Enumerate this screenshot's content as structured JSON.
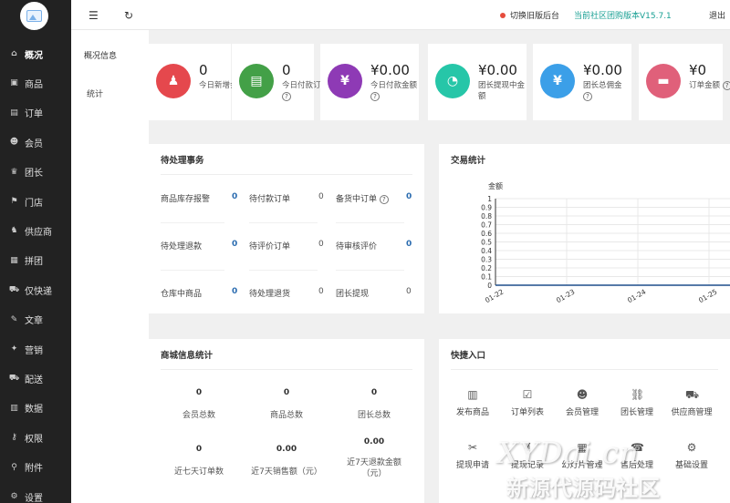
{
  "sidebar": {
    "items": [
      {
        "label": "概况",
        "icon": "home-icon"
      },
      {
        "label": "商品",
        "icon": "goods-icon"
      },
      {
        "label": "订单",
        "icon": "order-icon"
      },
      {
        "label": "会员",
        "icon": "members-icon"
      },
      {
        "label": "团长",
        "icon": "leader-icon"
      },
      {
        "label": "门店",
        "icon": "store-icon"
      },
      {
        "label": "供应商",
        "icon": "supplier-icon"
      },
      {
        "label": "拼团",
        "icon": "group-buy-icon"
      },
      {
        "label": "仅快递",
        "icon": "express-icon"
      },
      {
        "label": "文章",
        "icon": "article-icon"
      },
      {
        "label": "营销",
        "icon": "marketing-icon"
      },
      {
        "label": "配送",
        "icon": "delivery-icon"
      },
      {
        "label": "数据",
        "icon": "data-icon"
      },
      {
        "label": "权限",
        "icon": "permission-icon"
      },
      {
        "label": "附件",
        "icon": "attachment-icon"
      },
      {
        "label": "设置",
        "icon": "settings-icon"
      }
    ]
  },
  "subnav": {
    "items": [
      "概况信息",
      "统计"
    ]
  },
  "topbar": {
    "switch_label": "切换旧版后台",
    "version_label": "当前社区团购版本V15.7.1",
    "logout_label": "退出"
  },
  "stats": [
    {
      "value": "0",
      "label": "今日新增会员",
      "color": "#e5484d",
      "icon": "add-user-icon",
      "help": false
    },
    {
      "value": "0",
      "label": "今日付款订单",
      "color": "#43a047",
      "icon": "document-icon",
      "help": true
    },
    {
      "value": "¥0.00",
      "label": "今日付款金额",
      "color": "#8e3ab5",
      "icon": "yen-icon",
      "help": true
    },
    {
      "value": "¥0.00",
      "label": "团长提现中金额",
      "color": "#26c6a8",
      "icon": "pie-icon",
      "help": false
    },
    {
      "value": "¥0.00",
      "label": "团长总佣金",
      "color": "#3b9fe8",
      "icon": "money-bag-icon",
      "help": true
    },
    {
      "value": "¥0",
      "label": "订单金额",
      "color": "#e0607a",
      "icon": "doc-icon",
      "help": true
    }
  ],
  "pending": {
    "title": "待处理事务",
    "rows": [
      [
        {
          "label": "商品库存报警",
          "value": "0",
          "blue": true,
          "help": false
        },
        {
          "label": "待付款订单",
          "value": "0",
          "blue": false,
          "help": false
        },
        {
          "label": "备货中订单",
          "value": "0",
          "blue": true,
          "help": true
        }
      ],
      [
        {
          "label": "待处理退款",
          "value": "0",
          "blue": true,
          "help": false
        },
        {
          "label": "待评价订单",
          "value": "0",
          "blue": false,
          "help": false
        },
        {
          "label": "待审核评价",
          "value": "0",
          "blue": true,
          "help": false
        }
      ],
      [
        {
          "label": "仓库中商品",
          "value": "0",
          "blue": true,
          "help": false
        },
        {
          "label": "待处理退货",
          "value": "0",
          "blue": false,
          "help": false
        },
        {
          "label": "团长提现",
          "value": "0",
          "blue": false,
          "help": false
        }
      ]
    ]
  },
  "trade": {
    "title": "交易统计"
  },
  "chart_data": {
    "type": "line",
    "title": "",
    "ylabel": "金额",
    "xlabel": "",
    "ylim": [
      0,
      1
    ],
    "yticks": [
      "0",
      "0.1",
      "0.2",
      "0.3",
      "0.4",
      "0.5",
      "0.6",
      "0.7",
      "0.8",
      "0.9",
      "1"
    ],
    "categories": [
      "01-22",
      "01-23",
      "01-24",
      "01-25"
    ],
    "series": [
      {
        "values": [
          0,
          0,
          0,
          0
        ],
        "color": "#1f4e8c"
      }
    ],
    "grid": true
  },
  "mall": {
    "title": "商城信息统计",
    "items": [
      {
        "value": "0",
        "label": "会员总数"
      },
      {
        "value": "0",
        "label": "商品总数"
      },
      {
        "value": "0",
        "label": "团长总数"
      },
      {
        "value": "0",
        "label": "近七天订单数"
      },
      {
        "value": "0.00",
        "label": "近7天销售额（元）"
      },
      {
        "value": "0.00",
        "label": "近7天退款金额（元）"
      }
    ]
  },
  "shortcuts": {
    "title": "快捷入口",
    "items": [
      {
        "label": "发布商品",
        "icon": "barcode-icon"
      },
      {
        "label": "订单列表",
        "icon": "clipboard-icon"
      },
      {
        "label": "会员管理",
        "icon": "user-icon"
      },
      {
        "label": "团长管理",
        "icon": "hierarchy-icon"
      },
      {
        "label": "供应商管理",
        "icon": "truck-icon"
      },
      {
        "label": "提现申请",
        "icon": "ticket-icon"
      },
      {
        "label": "提现记录",
        "icon": "yen-circle-icon"
      },
      {
        "label": "幻灯片管理",
        "icon": "slides-icon"
      },
      {
        "label": "售后处理",
        "icon": "service-icon"
      },
      {
        "label": "基础设置",
        "icon": "gear-icon"
      }
    ]
  },
  "watermark": {
    "line1": "XYDai.cn",
    "line2": "新源代源码社区"
  }
}
